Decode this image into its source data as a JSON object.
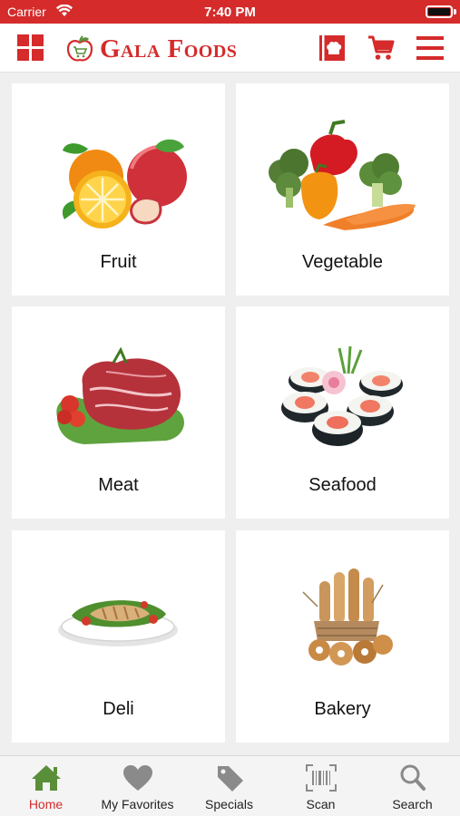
{
  "status_bar": {
    "carrier": "Carrier",
    "time": "7:40 PM"
  },
  "header": {
    "brand": "Gala Foods"
  },
  "categories": [
    {
      "label": "Fruit",
      "image": "fruit-image"
    },
    {
      "label": "Vegetable",
      "image": "vegetable-image"
    },
    {
      "label": "Meat",
      "image": "meat-image"
    },
    {
      "label": "Seafood",
      "image": "seafood-image"
    },
    {
      "label": "Deli",
      "image": "deli-image"
    },
    {
      "label": "Bakery",
      "image": "bakery-image"
    }
  ],
  "tabs": [
    {
      "label": "Home",
      "icon": "home-icon",
      "active": true
    },
    {
      "label": "My Favorites",
      "icon": "heart-icon",
      "active": false
    },
    {
      "label": "Specials",
      "icon": "tag-icon",
      "active": false
    },
    {
      "label": "Scan",
      "icon": "barcode-icon",
      "active": false
    },
    {
      "label": "Search",
      "icon": "search-icon",
      "active": false
    }
  ],
  "colors": {
    "brand": "#d52b2b",
    "active_tab": "#d52b2b",
    "home_icon": "#5a8f3a",
    "inactive_icon": "#8a8a8a"
  }
}
